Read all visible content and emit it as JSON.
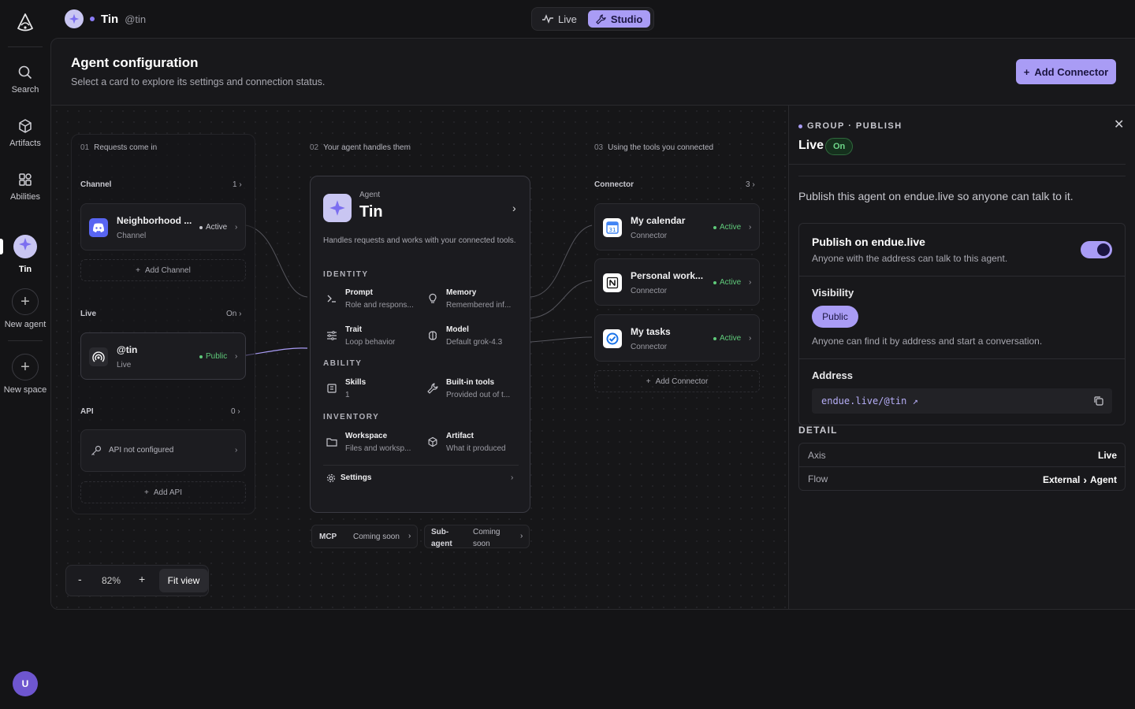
{
  "rail": {
    "search": "Search",
    "artifacts": "Artifacts",
    "abilities": "Abilities",
    "agent": "Tin",
    "new_agent": "New agent",
    "new_space": "New space",
    "user_initial": "U"
  },
  "topbar": {
    "agent_name": "Tin",
    "agent_handle": "@tin",
    "mode_live": "Live",
    "mode_studio": "Studio",
    "selected_mode": "Studio"
  },
  "header": {
    "title": "Agent configuration",
    "subtitle": "Select a card to explore its settings and connection status.",
    "add_connector": "Add Connector"
  },
  "steps": {
    "s1_num": "01",
    "s1_label": "Requests come in",
    "s2_num": "02",
    "s2_label": "Your agent handles them",
    "s3_num": "03",
    "s3_label": "Using the tools you connected"
  },
  "channel": {
    "label": "Channel",
    "count": "1",
    "card_title": "Neighborhood ...",
    "card_sub": "Channel",
    "card_status": "Active",
    "add": "Add Channel"
  },
  "live": {
    "label": "Live",
    "count": "On",
    "card_title": "@tin",
    "card_sub": "Live",
    "card_status": "Public"
  },
  "api": {
    "label": "API",
    "count": "0",
    "card_title": "API not configured",
    "add": "Add API"
  },
  "agent_card": {
    "kind": "Agent",
    "name": "Tin",
    "desc": "Handles requests and works with your connected tools.",
    "identity": "IDENTITY",
    "ability": "ABILITY",
    "inventory": "INVENTORY",
    "prompt_t": "Prompt",
    "prompt_s": "Role and respons...",
    "memory_t": "Memory",
    "memory_s": "Remembered inf...",
    "trait_t": "Trait",
    "trait_s": "Loop behavior",
    "model_t": "Model",
    "model_s": "Default grok-4.3",
    "skills_t": "Skills",
    "skills_s": "1",
    "builtin_t": "Built-in tools",
    "builtin_s": "Provided out of t...",
    "workspace_t": "Workspace",
    "workspace_s": "Files and worksp...",
    "artifact_t": "Artifact",
    "artifact_s": "What it produced",
    "settings": "Settings"
  },
  "below_agent": {
    "mcp": "MCP",
    "mcp_status": "Coming soon",
    "sub_agent_1": "Sub-",
    "sub_agent_2": "agent",
    "sub_status_1": "Coming",
    "sub_status_2": "soon"
  },
  "connectors": {
    "label": "Connector",
    "count": "3",
    "items": [
      {
        "title": "My calendar",
        "sub": "Connector",
        "status": "Active"
      },
      {
        "title": "Personal work...",
        "sub": "Connector",
        "status": "Active"
      },
      {
        "title": "My tasks",
        "sub": "Connector",
        "status": "Active"
      }
    ],
    "add": "Add Connector"
  },
  "zoom": {
    "minus": "-",
    "value": "82%",
    "plus": "+",
    "fit": "Fit view"
  },
  "detail": {
    "group": "GROUP · PUBLISH",
    "title": "Live",
    "badge": "On",
    "intro": "Publish this agent on endue.live so anyone can talk to it.",
    "publish_title": "Publish on endue.live",
    "publish_sub": "Anyone with the address can talk to this agent.",
    "publish_enabled": true,
    "visibility_label": "Visibility",
    "visibility_value": "Public",
    "visibility_desc": "Anyone can find it by address and start a conversation.",
    "address_label": "Address",
    "address_value": "endue.live/@tin ↗",
    "detail_label": "DETAIL",
    "axis_k": "Axis",
    "axis_v": "Live",
    "flow_k": "Flow",
    "flow_from": "External",
    "flow_to": "Agent"
  },
  "colors": {
    "accent": "#a99cf5",
    "active": "#5fca7a",
    "background": "#141416"
  }
}
